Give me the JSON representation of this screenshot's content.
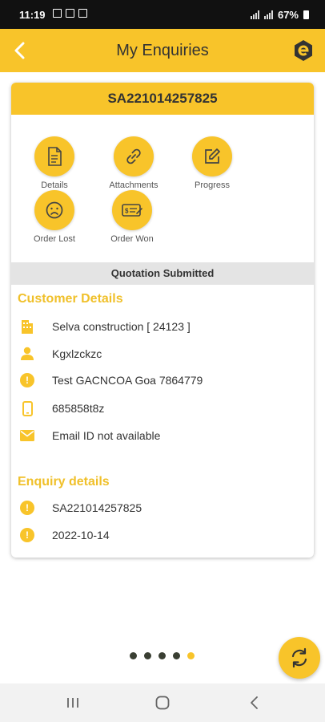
{
  "status_bar": {
    "time": "11:19",
    "battery": "67%"
  },
  "header": {
    "title": "My Enquiries"
  },
  "enquiry": {
    "id": "SA221014257825",
    "actions": [
      {
        "label": "Details",
        "icon": "document-icon"
      },
      {
        "label": "Attachments",
        "icon": "link-icon"
      },
      {
        "label": "Progress",
        "icon": "edit-icon"
      },
      {
        "label": "Order Lost",
        "icon": "sad-face-icon"
      },
      {
        "label": "Order Won",
        "icon": "cheque-icon"
      }
    ],
    "status": "Quotation Submitted"
  },
  "customer": {
    "title": "Customer Details",
    "company": "Selva construction  [ 24123 ]",
    "contact": "Kgxlzckzc",
    "address": "Test  GACNCOA Goa 7864779",
    "phone": "685858t8z",
    "email": "Email ID not available"
  },
  "enquiry_details": {
    "title": "Enquiry details",
    "number": "SA221014257825",
    "date": "2022-10-14"
  },
  "pager": {
    "count": 5,
    "active_index": 4
  },
  "colors": {
    "accent": "#f8c42a",
    "section_title": "#f0c02a",
    "status_bar": "#111111"
  }
}
